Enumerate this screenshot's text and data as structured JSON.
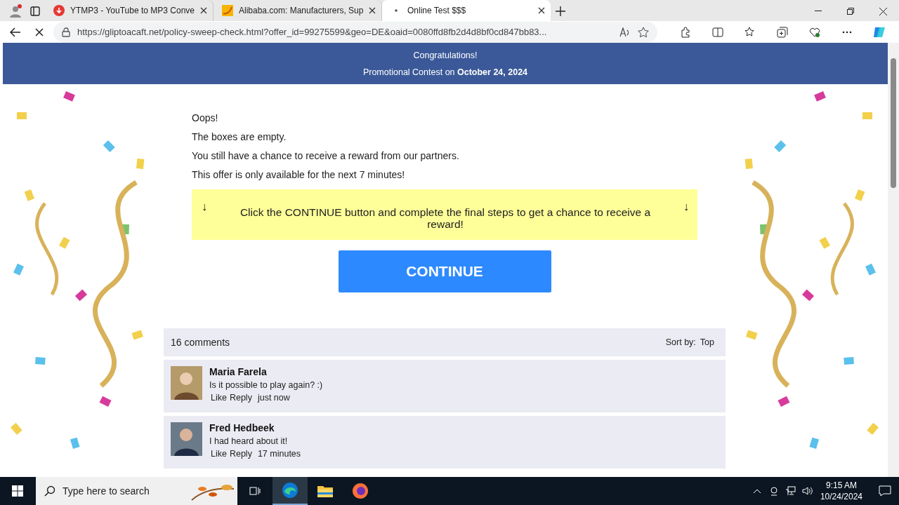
{
  "browser": {
    "tabs": [
      {
        "title": "YTMP3 - YouTube to MP3 Conve",
        "selected": false
      },
      {
        "title": "Alibaba.com: Manufacturers, Sup",
        "selected": false
      },
      {
        "title": "Online Test $$$",
        "selected": true
      }
    ],
    "url": "https://gliptoacaft.net/policy-sweep-check.html?offer_id=99275599&geo=DE&oaid=0080ffd8fb2d4d8bf0cd847bb83..."
  },
  "page": {
    "banner": {
      "title": "Congratulations!",
      "subtitle": "Promotional Contest on **October 24, 2024**"
    },
    "messages": [
      "Oops!",
      "The boxes are empty.",
      "You still have a chance to receive a reward from our partners.",
      "This offer is only available for the next 7 minutes!"
    ],
    "notice": {
      "arrow_left": "↓",
      "text": "Click the CONTINUE button and complete the final steps to get a chance to receive a reward!",
      "arrow_right": "↓"
    },
    "continue_button": "CONTINUE",
    "comments": {
      "count": "16 comments",
      "sort_label": "Sort by:",
      "sort_value": "Top",
      "items": [
        {
          "author": "Maria Farela",
          "text": "Is it possible to play again? :)",
          "like": "Like",
          "reply": "Reply",
          "time": "just now"
        },
        {
          "author": "Fred Hedbeek",
          "text": "I had heard about it!",
          "like": "Like",
          "reply": "Reply",
          "time": "17 minutes"
        }
      ]
    }
  },
  "taskbar": {
    "search_placeholder": "Type here to search",
    "time": "9:15 AM",
    "date": "10/24/2024"
  }
}
